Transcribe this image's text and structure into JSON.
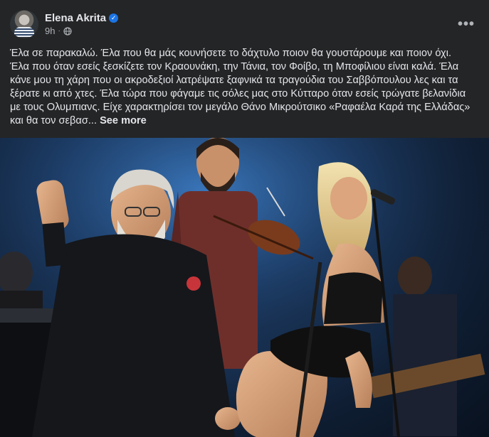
{
  "author": {
    "name": "Elena Akrita",
    "verified_icon": "verified-badge-icon",
    "time": "9h",
    "separator": "·",
    "audience_icon": "globe-icon"
  },
  "menu": {
    "icon": "more-options-icon",
    "glyph": "•••"
  },
  "post": {
    "text": "Έλα σε παρακαλώ. Έλα που θα μάς κουνήσετε το δάχτυλο ποιον θα γουστάρουμε και ποιον όχι. Έλα που όταν εσείς ξεσκίζετε τον Κραουνάκη, την Τάνια, τον Φοίβο, τη Μποφίλιου είναι καλά. Έλα κάνε μου τη χάρη που οι ακροδεξιοί λατρέψατε ξαφνικά τα τραγούδια του Σαββόπουλου λες και τα ξέρατε κι από χτες. Έλα τώρα που φάγαμε τις σόλες μας στο Κύτταρο όταν εσείς τρώγατε βελανίδια με τους Ολυμπιανς. Είχε χαρακτηρίσει τον μεγάλο Θάνο Μικρούτσικο «Ραφαέλα Καρά της Ελλάδας» και θα τον σεβασ...",
    "see_more": "See more"
  },
  "photo": {
    "description_icon": "concert-photo"
  },
  "colors": {
    "background": "#242526",
    "text_primary": "#e4e6eb",
    "text_secondary": "#b0b3b8",
    "verified_blue": "#1b74e4"
  }
}
